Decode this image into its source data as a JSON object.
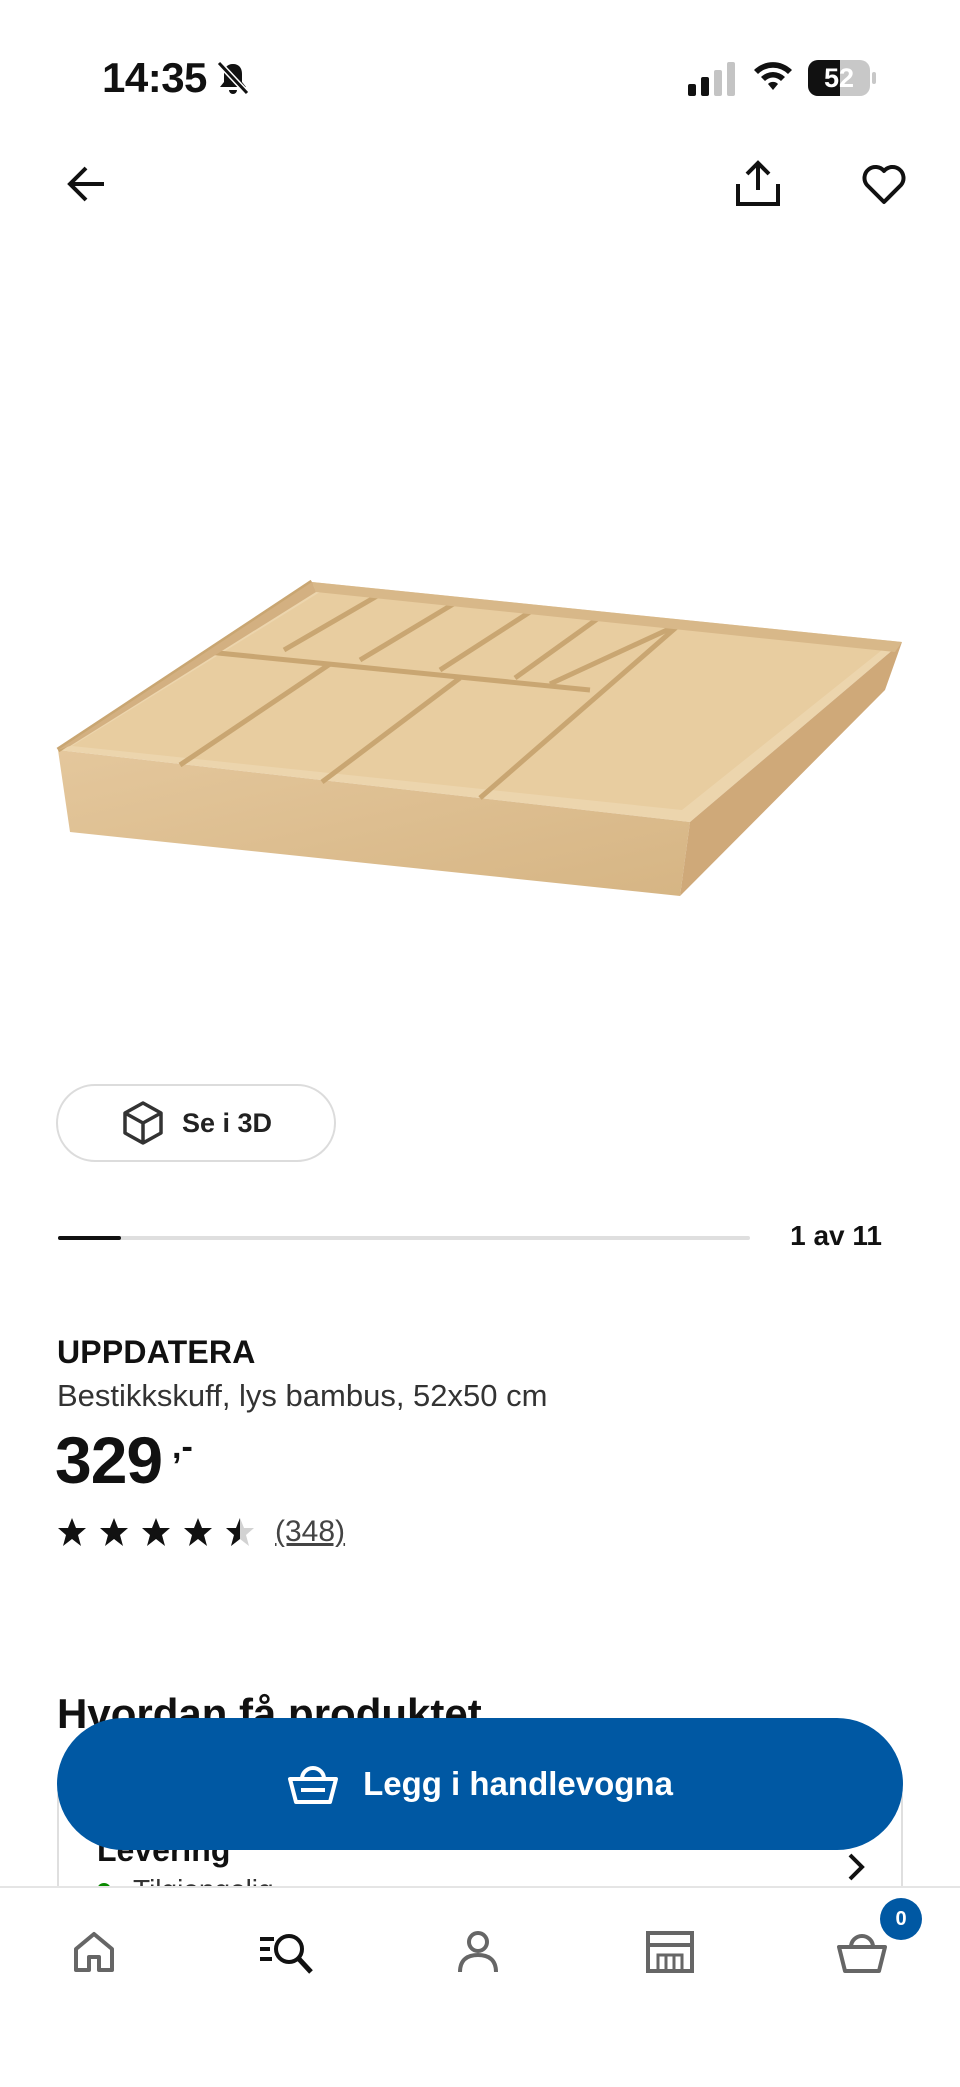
{
  "status_bar": {
    "time": "14:35",
    "battery_percent": "52",
    "battery_level": 0.52
  },
  "icons": {
    "back": "arrow-left-icon",
    "share": "share-icon",
    "favorite": "heart-icon",
    "view3d": "cube-icon",
    "cart": "shopping-basket-icon"
  },
  "gallery": {
    "view3d_label": "Se i 3D",
    "position_text": "1 av 11",
    "current": 1,
    "total": 11
  },
  "product": {
    "name": "UPPDATERA",
    "description": "Bestikkskuff, lys bambus, 52x50 cm",
    "price": "329",
    "price_suffix": ",-",
    "rating": 4.5,
    "reviews_count": "(348)"
  },
  "availability": {
    "heading": "Hvordan få produktet",
    "card_title": "Levering",
    "card_status": "Tilgjengelig"
  },
  "cart_button": {
    "label": "Legg i handlevogna"
  },
  "bottom_nav": {
    "items": [
      "home",
      "search",
      "profile",
      "store",
      "cart"
    ],
    "cart_count": "0"
  },
  "colors": {
    "brand_blue": "#0058a3",
    "available_green": "#0a8a00",
    "text": "#111111"
  }
}
